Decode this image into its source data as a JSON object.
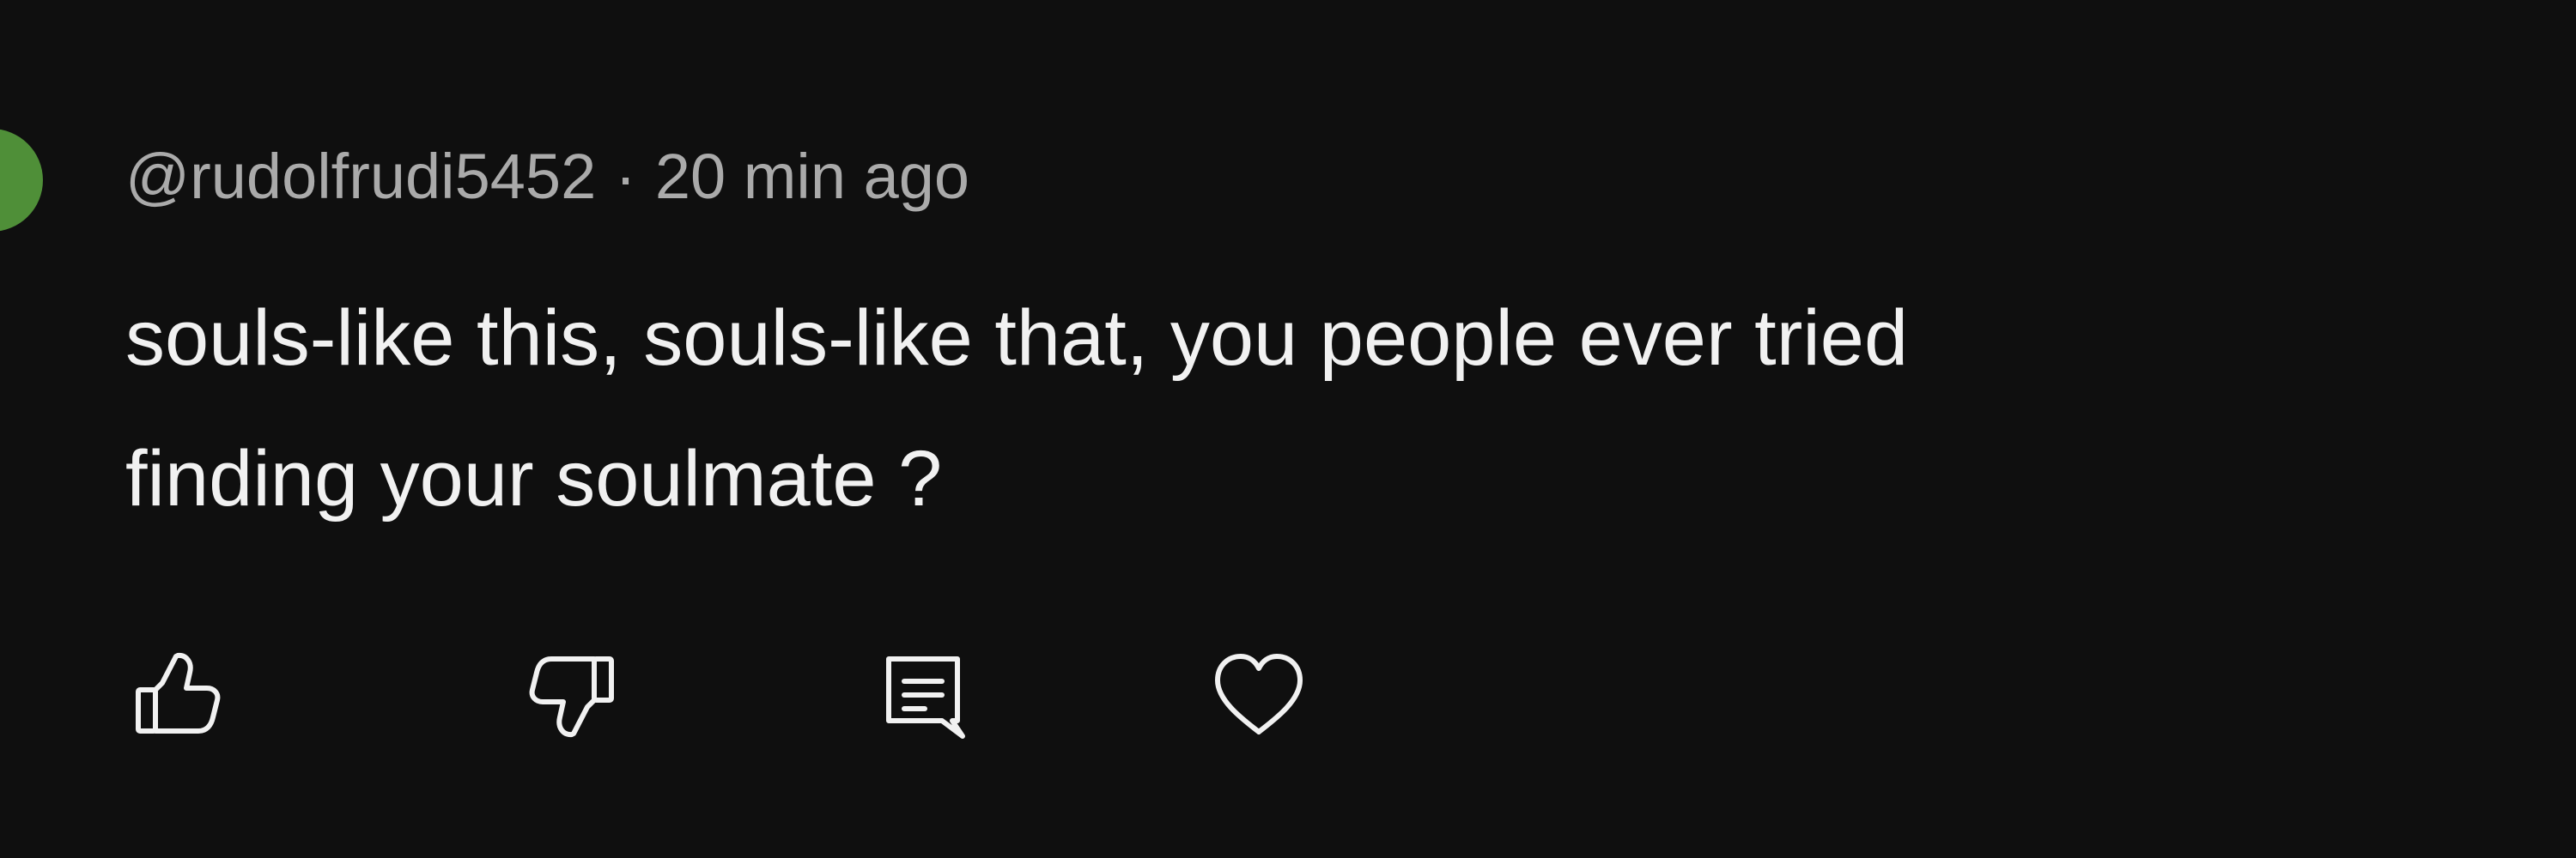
{
  "comment": {
    "author": "@rudolfrudi5452",
    "separator": "·",
    "timestamp": "20 min ago",
    "text": "souls-like this, souls-like that, you people ever tried\nfinding your soulmate ?",
    "avatar_color": "#4f8f38"
  },
  "actions": {
    "like_icon": "thumbs-up-icon",
    "dislike_icon": "thumbs-down-icon",
    "reply_icon": "reply-comment-icon",
    "heart_icon": "heart-icon"
  },
  "colors": {
    "background": "#0f0f0f",
    "primary_text": "#f1f1f1",
    "secondary_text": "#aaaaaa"
  }
}
